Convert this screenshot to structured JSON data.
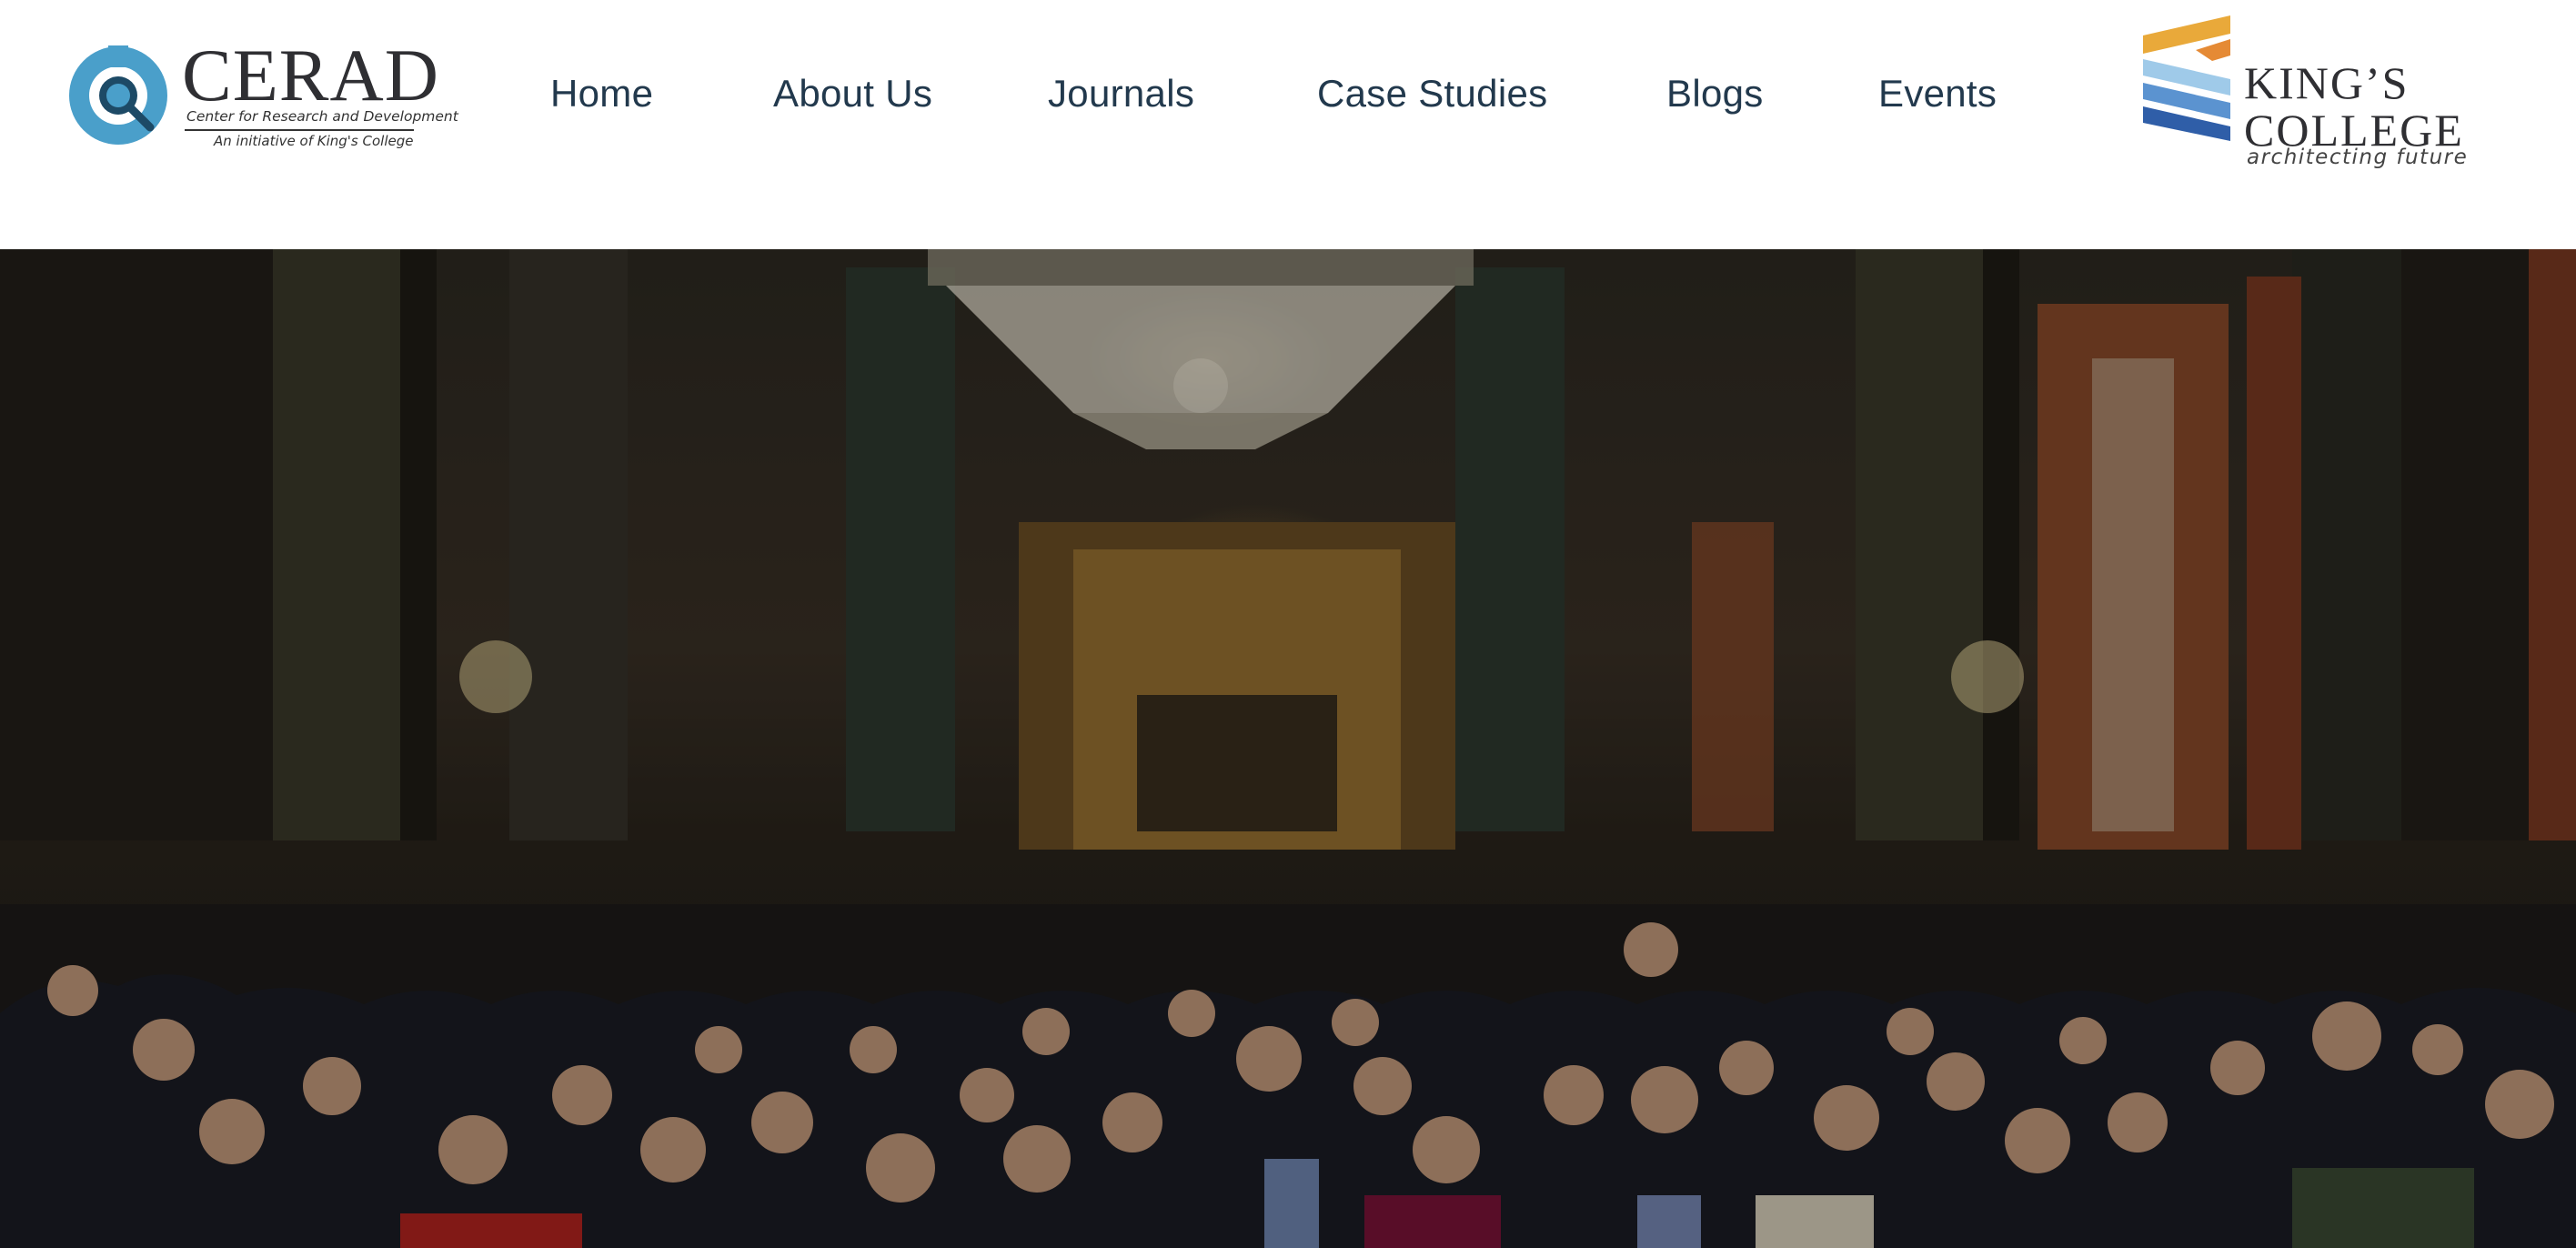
{
  "header": {
    "cerad_logo": {
      "title": "CERAD",
      "subtitle": "Center for Research and Development",
      "tagline": "An initiative of King's College",
      "icon": "magnifier-icon",
      "accent_color": "#4a9fca"
    },
    "nav": {
      "items": [
        {
          "label": "Home"
        },
        {
          "label": "About Us"
        },
        {
          "label": "Journals"
        },
        {
          "label": "Case Studies"
        },
        {
          "label": "Blogs"
        },
        {
          "label": "Events"
        }
      ],
      "text_color": "#22394d"
    },
    "kings_logo": {
      "line1": "KING’S",
      "line2": "COLLEGE",
      "tagline": "architecting future",
      "stripe_colors": [
        "#e9a93a",
        "#e58a35",
        "#9fcae9",
        "#5b93d0",
        "#2f5ea8"
      ]
    }
  },
  "hero": {
    "image": "group-photo-in-ornate-hall",
    "overlay": "dark"
  }
}
